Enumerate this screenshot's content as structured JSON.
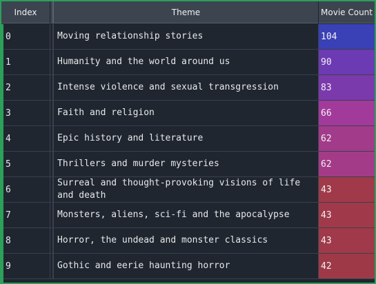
{
  "table": {
    "columns": [
      "Index",
      "Theme",
      "Movie Count"
    ],
    "rows": [
      {
        "index": "0",
        "theme": "Moving relationship stories",
        "count": "104",
        "color": "#3a40b5"
      },
      {
        "index": "1",
        "theme": "Humanity and the world around us",
        "count": "90",
        "color": "#6c3ab2"
      },
      {
        "index": "2",
        "theme": "Intense violence and sexual transgression",
        "count": "83",
        "color": "#7b3aac"
      },
      {
        "index": "3",
        "theme": "Faith and religion",
        "count": "66",
        "color": "#a23a9c"
      },
      {
        "index": "4",
        "theme": "Epic history and literature",
        "count": "62",
        "color": "#a23b8a"
      },
      {
        "index": "5",
        "theme": "Thrillers and murder mysteries",
        "count": "62",
        "color": "#a43b88"
      },
      {
        "index": "6",
        "theme": "Surreal and thought-provoking visions of life and death",
        "count": "43",
        "color": "#a03a4a"
      },
      {
        "index": "7",
        "theme": "Monsters, aliens, sci-fi and the apocalypse",
        "count": "43",
        "color": "#a03a4a"
      },
      {
        "index": "8",
        "theme": "Horror, the undead and monster classics",
        "count": "43",
        "color": "#a03a4a"
      },
      {
        "index": "9",
        "theme": "Gothic and eerie haunting horror",
        "count": "42",
        "color": "#9e3a48"
      }
    ]
  },
  "colors": {
    "header_bg": "#3c4450",
    "table_bg": "#1f2630",
    "window_border": "#2ca05a"
  }
}
